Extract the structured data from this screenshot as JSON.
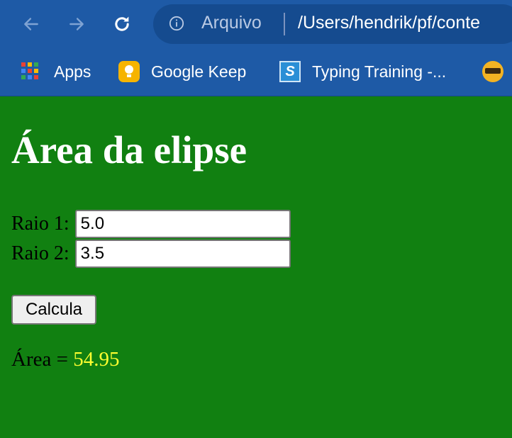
{
  "browser": {
    "nav": {
      "back_icon": "arrow-left-icon",
      "forward_icon": "arrow-right-icon",
      "reload_icon": "reload-icon"
    },
    "omnibox": {
      "info_icon": "info-icon",
      "scheme_label": "Arquivo",
      "url": "/Users/hendrik/pf/conte"
    },
    "bookmarks": [
      {
        "label": "Apps",
        "icon": "apps-grid-icon"
      },
      {
        "label": "Google Keep",
        "icon": "google-keep-icon"
      },
      {
        "label": "Typing Training -...",
        "icon": "typing-training-icon"
      },
      {
        "label": "",
        "icon": "emoji-face-icon"
      }
    ]
  },
  "page": {
    "title": "Área da elipse",
    "fields": [
      {
        "label": "Raio 1:",
        "value": "5.0"
      },
      {
        "label": "Raio 2:",
        "value": "3.5"
      }
    ],
    "button_label": "Calcula",
    "result_label": "Área =",
    "result_value": "54.95"
  },
  "colors": {
    "page_background": "#118011",
    "title_color": "#ffffff",
    "result_value_color": "#ffff30",
    "browser_bar": "#1e5aa6"
  }
}
